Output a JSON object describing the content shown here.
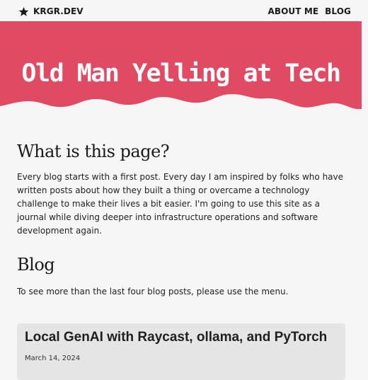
{
  "nav": {
    "brand": "KRGR.DEV",
    "brand_icon": "star-icon",
    "links": [
      "ABOUT ME",
      "BLOG"
    ]
  },
  "hero": {
    "title": "Old Man Yelling at Tech",
    "background_color": "#e04a63"
  },
  "about": {
    "heading": "What is this page?",
    "text": "Every blog starts with a first post. Every day I am inspired by folks who have written posts about how they built a thing or overcame a technology challenge to make their lives a bit easier. I'm going to use this site as a journal while diving deeper into infrastructure operations and software development again."
  },
  "blog": {
    "heading": "Blog",
    "note": "To see more than the last four blog posts, please use the menu.",
    "posts": [
      {
        "title": "Local GenAI with Raycast, ollama, and PyTorch",
        "date": "March 14, 2024"
      }
    ]
  }
}
